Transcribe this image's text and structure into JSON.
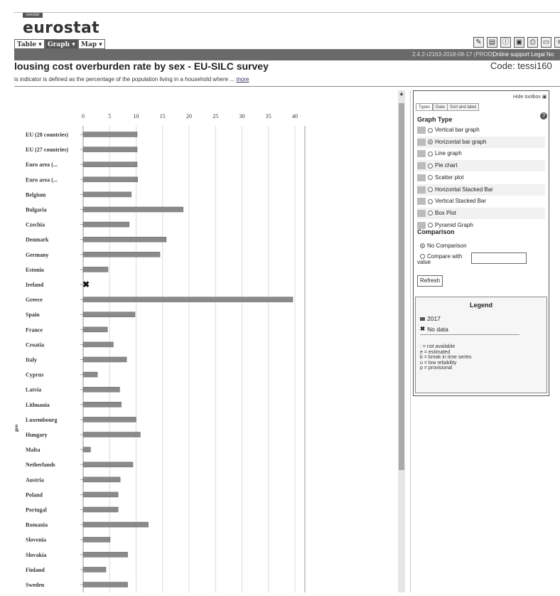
{
  "header": {
    "logo_small": "eurostat",
    "logo": "eurostat",
    "tabs": [
      {
        "label": "Table ▾",
        "active": false
      },
      {
        "label": "Graph ▾",
        "active": true
      },
      {
        "label": "Map ▾",
        "active": false
      }
    ],
    "version": "2.4.2-r2163-2018-08-17 (PROD)",
    "links": "Online support   Legal No",
    "tool_icons": [
      "edit-icon",
      "bookmark-icon",
      "info-icon",
      "save-icon",
      "print-icon",
      "window-icon",
      "share-icon"
    ]
  },
  "page": {
    "title": "lousing cost overburden rate by sex - EU-SILC survey",
    "code": "Code: tessi160",
    "description": "is indicator is defined as the percentage of the population living in a household where ...",
    "more_link": "more"
  },
  "toolbox": {
    "hide_label": "Hide toolbox",
    "tabs": [
      "Types",
      "Data",
      "Sort and label"
    ],
    "graph_type_title": "Graph Type",
    "graph_types": [
      {
        "label": "Vertical bar graph",
        "selected": false
      },
      {
        "label": "Horizontal bar graph",
        "selected": true
      },
      {
        "label": "Line graph",
        "selected": false
      },
      {
        "label": "Pie chart",
        "selected": false
      },
      {
        "label": "Scatter plot",
        "selected": false
      },
      {
        "label": "Horizontal Stacked Bar",
        "selected": false
      },
      {
        "label": "Vertical Stacked Bar",
        "selected": false
      },
      {
        "label": "Box Plot",
        "selected": false
      },
      {
        "label": "Pyramid Graph",
        "selected": false
      }
    ],
    "comparison_title": "Comparison",
    "no_comparison": "No Comparison",
    "compare_with": "Compare with",
    "compare_value": "value",
    "refresh": "Refresh"
  },
  "legend": {
    "title": "Legend",
    "series": "2017",
    "no_data": "No data",
    "flags": [
      ": = not available",
      "e = estimated",
      "b = break in time series",
      "u = low reliability",
      "p = provisional"
    ]
  },
  "chart_data": {
    "type": "bar",
    "orientation": "horizontal",
    "ylabel": "geo",
    "xlim": [
      0,
      40
    ],
    "xticks": [
      0,
      5,
      10,
      15,
      20,
      25,
      30,
      35,
      40
    ],
    "grid": true,
    "colors": {
      "bar": "#8a8a8a"
    },
    "categories": [
      "EU (28 countries)",
      "EU (27 countries)",
      "Euro area (...",
      "Euro area (...",
      "Belgium",
      "Bulgaria",
      "Czechia",
      "Denmark",
      "Germany",
      "Estonia",
      "Ireland",
      "Greece",
      "Spain",
      "France",
      "Croatia",
      "Italy",
      "Cyprus",
      "Latvia",
      "Lithuania",
      "Luxembourg",
      "Hungary",
      "Malta",
      "Netherlands",
      "Austria",
      "Poland",
      "Portugal",
      "Romania",
      "Slovenia",
      "Slovakia",
      "Finland",
      "Sweden"
    ],
    "series": [
      {
        "name": "2017",
        "values": [
          10.2,
          10.2,
          10.2,
          10.3,
          9.1,
          18.9,
          8.7,
          15.7,
          14.5,
          4.7,
          null,
          39.6,
          9.8,
          4.6,
          5.7,
          8.2,
          2.7,
          6.9,
          7.2,
          10.0,
          10.8,
          1.4,
          9.4,
          7.0,
          6.6,
          6.6,
          12.3,
          5.1,
          8.4,
          4.3,
          8.4
        ]
      }
    ]
  }
}
